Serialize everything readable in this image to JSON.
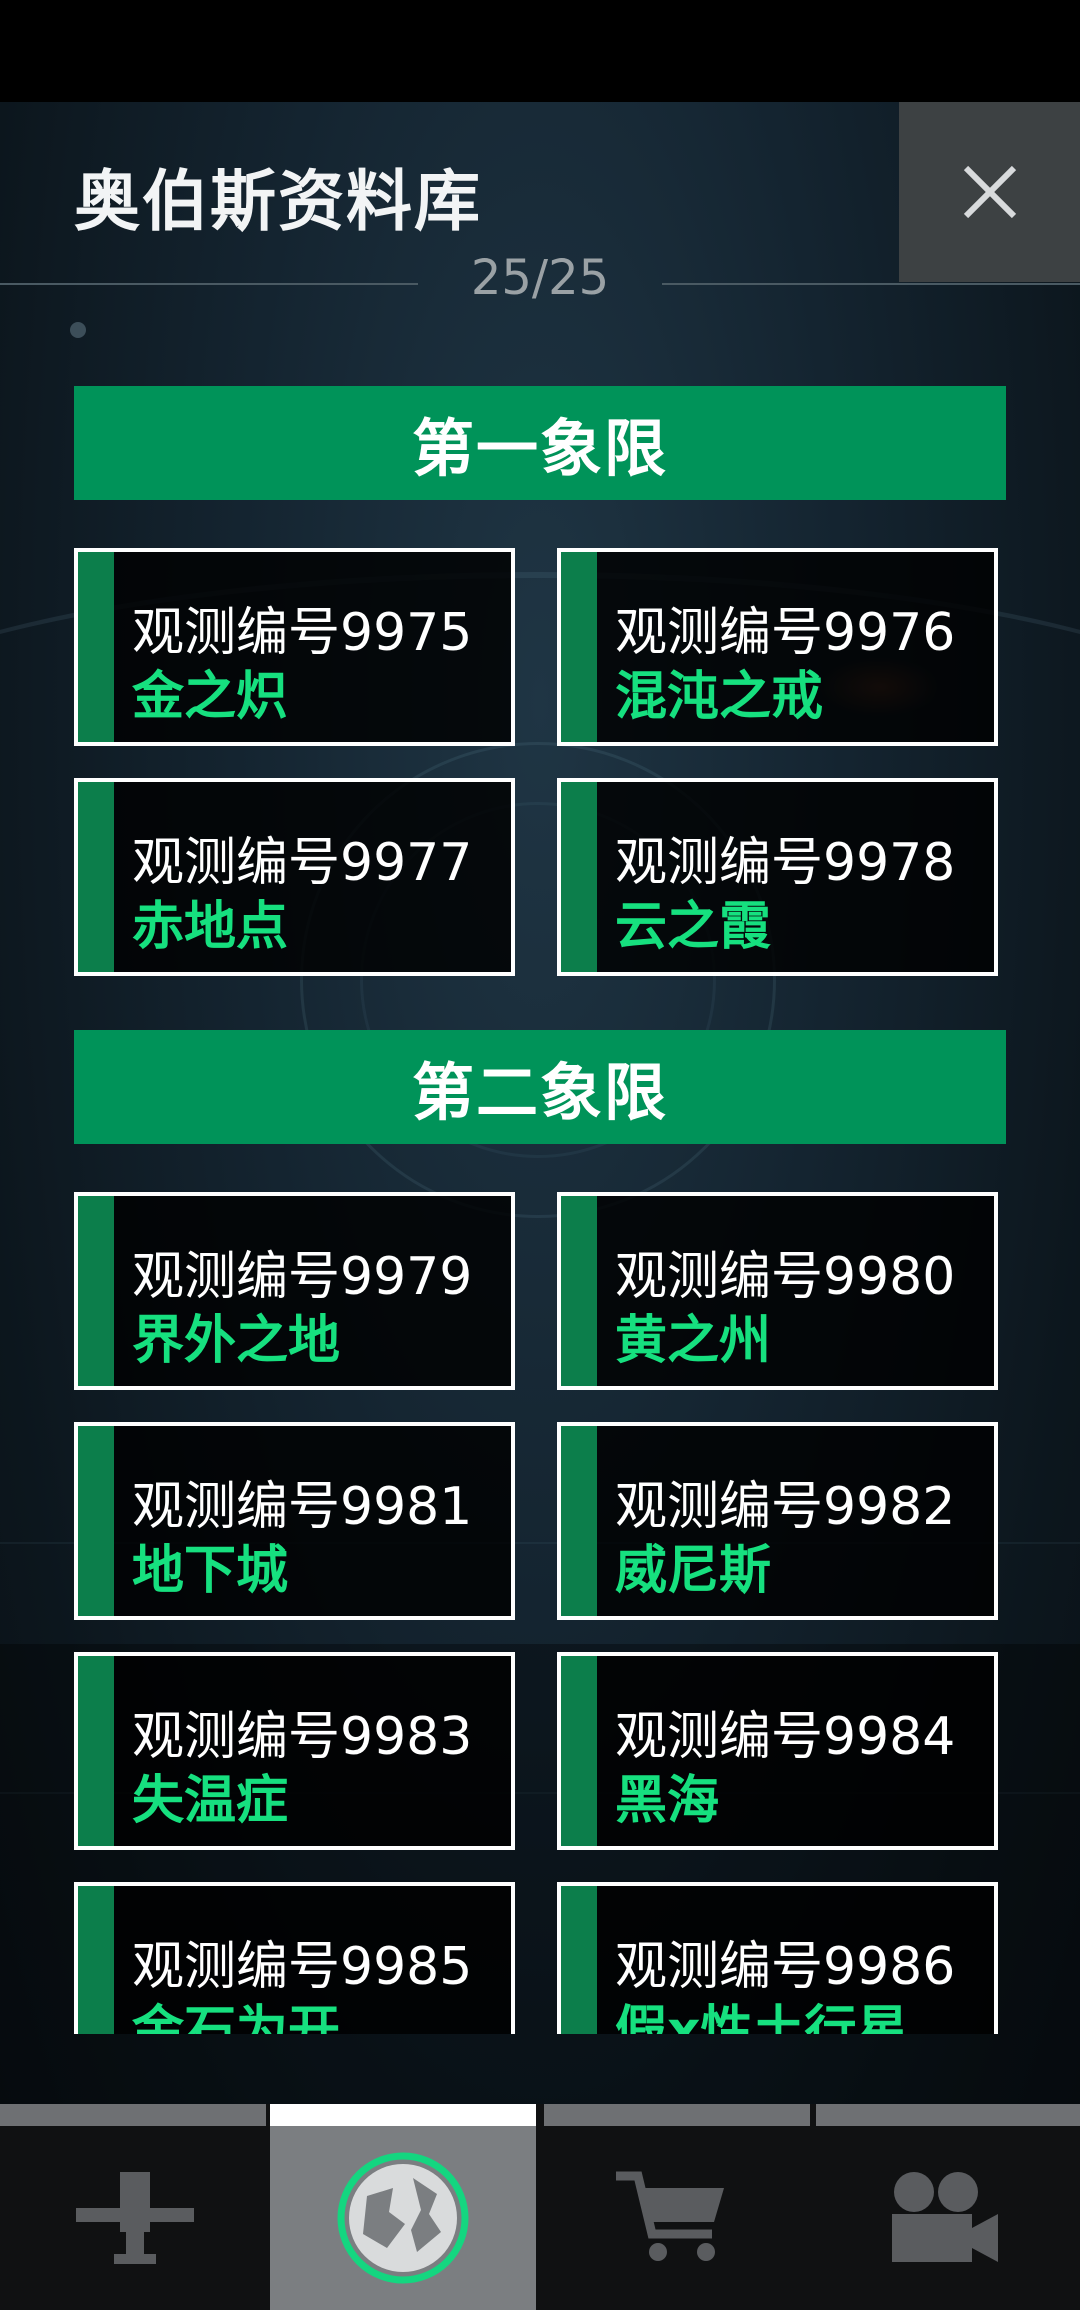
{
  "header": {
    "title": "奥伯斯资料库",
    "counter": "25/25"
  },
  "sections": [
    {
      "title": "第一象限",
      "cards": [
        {
          "code": "观测编号9975",
          "name": "金之炽"
        },
        {
          "code": "观测编号9976",
          "name": "混沌之戒"
        },
        {
          "code": "观测编号9977",
          "name": "赤地点"
        },
        {
          "code": "观测编号9978",
          "name": "云之霞"
        }
      ]
    },
    {
      "title": "第二象限",
      "cards": [
        {
          "code": "观测编号9979",
          "name": "界外之地"
        },
        {
          "code": "观测编号9980",
          "name": "黄之州"
        },
        {
          "code": "观测编号9981",
          "name": "地下城"
        },
        {
          "code": "观测编号9982",
          "name": "威尼斯"
        },
        {
          "code": "观测编号9983",
          "name": "失温症"
        },
        {
          "code": "观测编号9984",
          "name": "黑海"
        },
        {
          "code": "观测编号9985",
          "name": "金石为开"
        },
        {
          "code": "观测编号9986",
          "name": "假x性土行星"
        }
      ]
    }
  ],
  "nav": {
    "tabs": [
      {
        "icon": "tool-icon",
        "active": false
      },
      {
        "icon": "planet-icon",
        "active": true
      },
      {
        "icon": "cart-icon",
        "active": false
      },
      {
        "icon": "camera-icon",
        "active": false
      }
    ]
  },
  "colors": {
    "accent": "#009359",
    "accent_text": "#16e07f",
    "stripe": "#0c7e4b"
  }
}
